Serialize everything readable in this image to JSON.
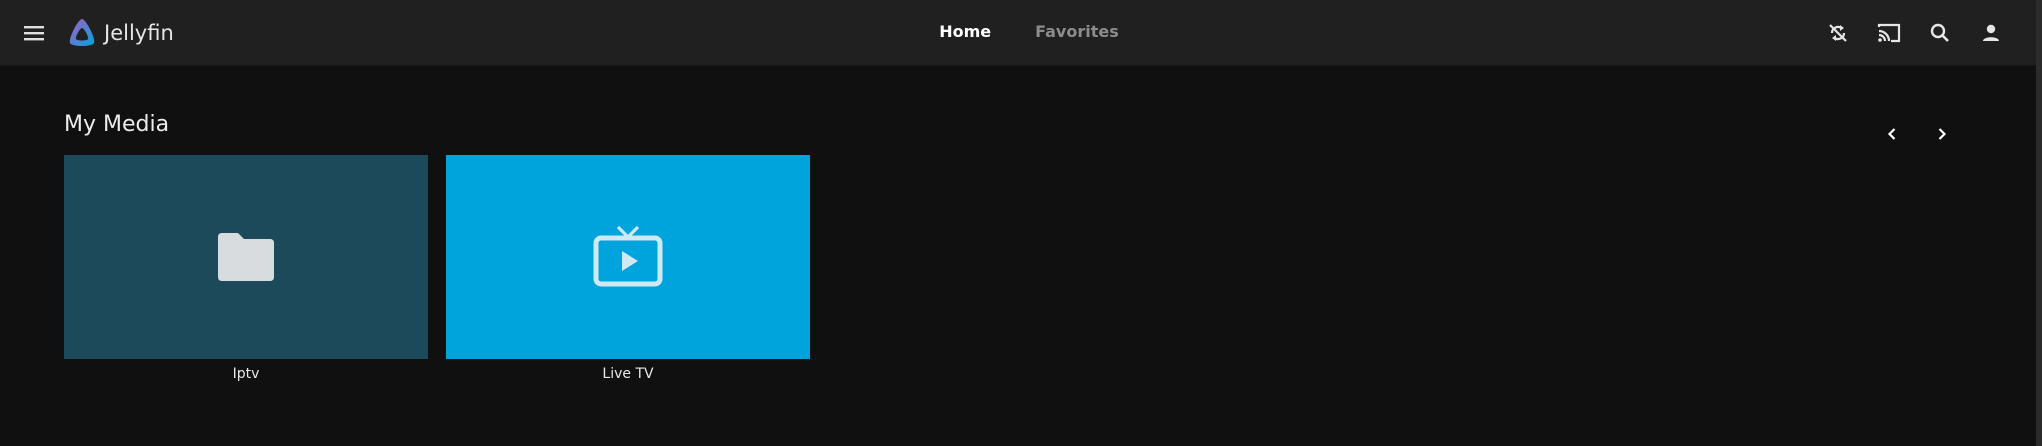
{
  "app": {
    "name": "Jellyfin"
  },
  "nav": {
    "tabs": [
      {
        "label": "Home",
        "active": true
      },
      {
        "label": "Favorites",
        "active": false
      }
    ]
  },
  "header_icons": [
    "sync-disabled-icon",
    "cast-icon",
    "search-icon",
    "user-icon"
  ],
  "section": {
    "title": "My Media"
  },
  "media": [
    {
      "label": "Iptv",
      "icon": "folder-icon",
      "color": "#1c4a5a"
    },
    {
      "label": "Live TV",
      "icon": "live-tv-icon",
      "color": "#00a4dc"
    }
  ],
  "colors": {
    "background": "#101010",
    "header": "#202020",
    "accent": "#00a4dc"
  }
}
